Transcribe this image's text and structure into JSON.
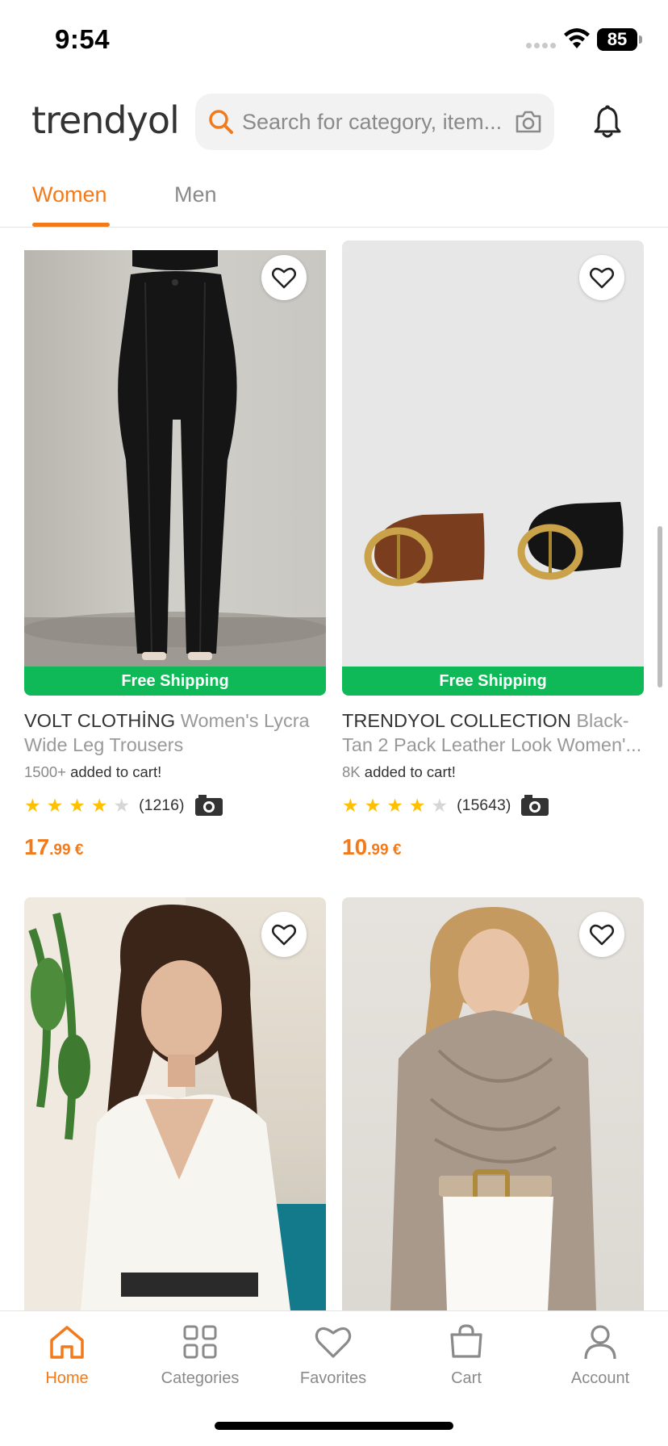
{
  "status_bar": {
    "time": "9:54",
    "battery": "85"
  },
  "header": {
    "logo": "trendyol",
    "search_placeholder": "Search for category, item...",
    "icons": [
      "search-icon",
      "camera-icon",
      "bell-icon"
    ]
  },
  "tabs": [
    {
      "label": "Women",
      "active": true
    },
    {
      "label": "Men",
      "active": false
    }
  ],
  "products": [
    {
      "brand": "VOLT CLOTHİNG",
      "name": "Women's Lycra Wide Leg Trousers",
      "badge": "Free Shipping",
      "added_count": "1500+",
      "added_text": "added to cart!",
      "stars": 4,
      "reviews": "(1216)",
      "price_int": "17",
      "price_dec": ".99 €"
    },
    {
      "brand": "TRENDYOL COLLECTION",
      "name": "Black-Tan 2 Pack Leather Look Women'...",
      "badge": "Free Shipping",
      "added_count": "8K",
      "added_text": "added to cart!",
      "stars": 4,
      "reviews": "(15643)",
      "price_int": "10",
      "price_dec": ".99 €"
    }
  ],
  "bottom_nav": [
    {
      "label": "Home",
      "icon": "home-icon",
      "active": true
    },
    {
      "label": "Categories",
      "icon": "grid-icon",
      "active": false
    },
    {
      "label": "Favorites",
      "icon": "heart-icon",
      "active": false
    },
    {
      "label": "Cart",
      "icon": "bag-icon",
      "active": false
    },
    {
      "label": "Account",
      "icon": "user-icon",
      "active": false
    }
  ],
  "colors": {
    "accent": "#f27a1a",
    "free_shipping": "#10b957",
    "star": "#ffc000"
  }
}
